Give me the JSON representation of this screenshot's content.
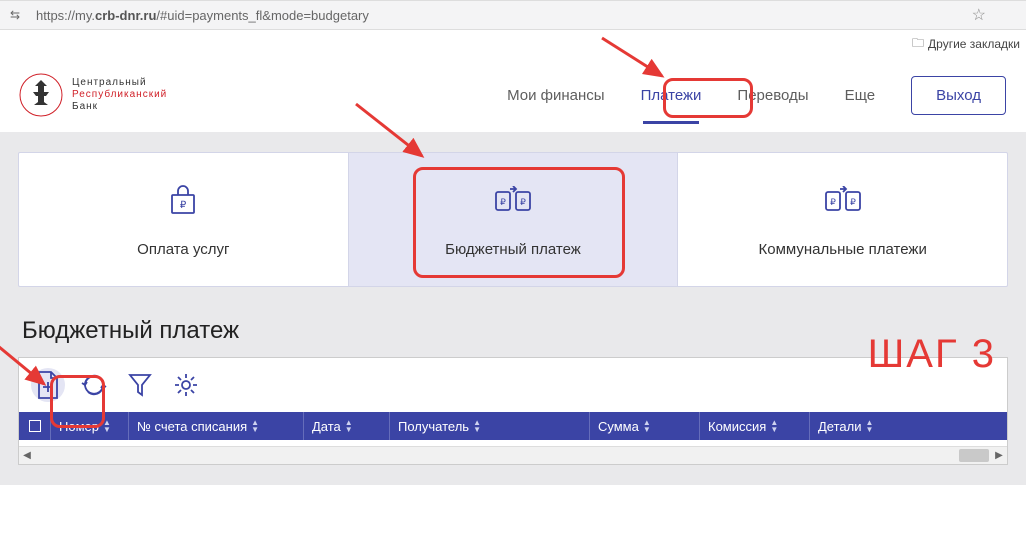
{
  "browser": {
    "url_prefix": "https://my.",
    "url_domain": "crb-dnr.ru",
    "url_path": "/#uid=payments_fl&mode=budgetary",
    "bookmarks_label": "Другие закладки"
  },
  "logo": {
    "line1": "Центральный",
    "line2": "Республиканский",
    "line3": "Банк"
  },
  "nav": {
    "items": [
      "Мои финансы",
      "Платежи",
      "Переводы",
      "Еще"
    ],
    "active_index": 1,
    "logout": "Выход"
  },
  "tabs": {
    "items": [
      {
        "label": "Оплата услуг"
      },
      {
        "label": "Бюджетный платеж"
      },
      {
        "label": "Коммунальные платежи"
      }
    ],
    "active_index": 1
  },
  "section_title": "Бюджетный платеж",
  "step_label": "ШАГ 3",
  "table": {
    "columns": [
      "Номер",
      "№ счета списания",
      "Дата",
      "Получатель",
      "Сумма",
      "Комиссия",
      "Детали"
    ]
  }
}
